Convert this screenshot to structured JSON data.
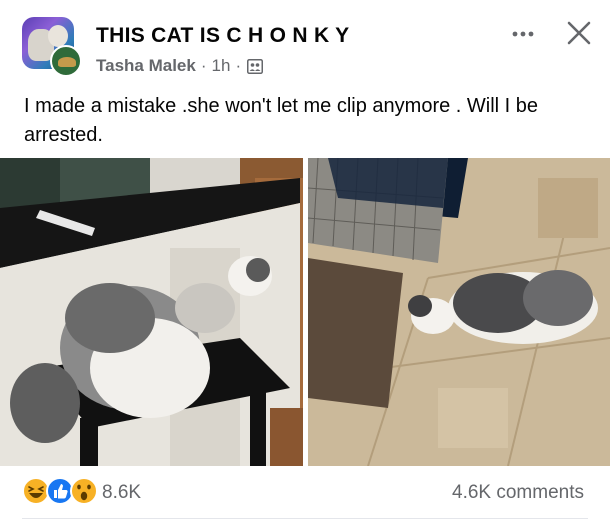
{
  "header": {
    "group_name": "THIS CAT IS C H O N K Y",
    "author": "Tasha Malek",
    "separator": "·",
    "timestamp": "1h",
    "audience_icon": "group-audience-icon",
    "more_icon": "more-options-icon",
    "close_icon": "close-icon"
  },
  "post": {
    "text": "I made a mistake .she won't let me clip anymore . Will I be arrested."
  },
  "footer": {
    "reaction_icons": [
      "haha-icon",
      "like-icon",
      "wow-icon"
    ],
    "reaction_count": "8.6K",
    "comments": "4.6K comments"
  },
  "colors": {
    "secondary_text": "#65676b",
    "primary_text": "#050505",
    "like_blue": "#1877f2",
    "reaction_yellow": "#f7b125"
  }
}
